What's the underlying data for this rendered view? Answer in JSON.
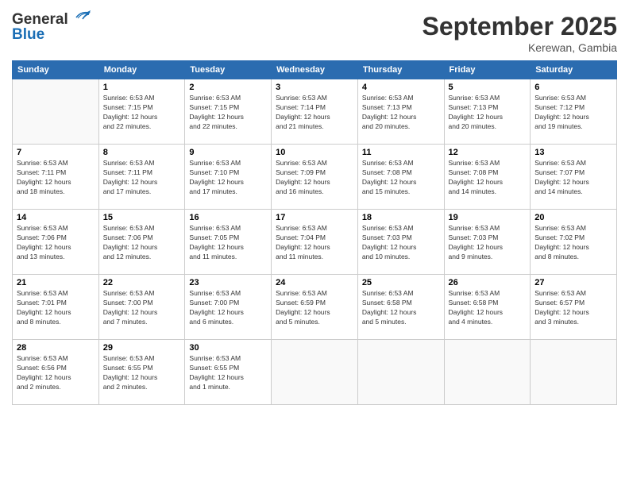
{
  "logo": {
    "line1": "General",
    "line2": "Blue"
  },
  "title": "September 2025",
  "location": "Kerewan, Gambia",
  "header_days": [
    "Sunday",
    "Monday",
    "Tuesday",
    "Wednesday",
    "Thursday",
    "Friday",
    "Saturday"
  ],
  "weeks": [
    [
      {
        "day": "",
        "info": ""
      },
      {
        "day": "1",
        "info": "Sunrise: 6:53 AM\nSunset: 7:15 PM\nDaylight: 12 hours\nand 22 minutes."
      },
      {
        "day": "2",
        "info": "Sunrise: 6:53 AM\nSunset: 7:15 PM\nDaylight: 12 hours\nand 22 minutes."
      },
      {
        "day": "3",
        "info": "Sunrise: 6:53 AM\nSunset: 7:14 PM\nDaylight: 12 hours\nand 21 minutes."
      },
      {
        "day": "4",
        "info": "Sunrise: 6:53 AM\nSunset: 7:13 PM\nDaylight: 12 hours\nand 20 minutes."
      },
      {
        "day": "5",
        "info": "Sunrise: 6:53 AM\nSunset: 7:13 PM\nDaylight: 12 hours\nand 20 minutes."
      },
      {
        "day": "6",
        "info": "Sunrise: 6:53 AM\nSunset: 7:12 PM\nDaylight: 12 hours\nand 19 minutes."
      }
    ],
    [
      {
        "day": "7",
        "info": "Sunrise: 6:53 AM\nSunset: 7:11 PM\nDaylight: 12 hours\nand 18 minutes."
      },
      {
        "day": "8",
        "info": "Sunrise: 6:53 AM\nSunset: 7:11 PM\nDaylight: 12 hours\nand 17 minutes."
      },
      {
        "day": "9",
        "info": "Sunrise: 6:53 AM\nSunset: 7:10 PM\nDaylight: 12 hours\nand 17 minutes."
      },
      {
        "day": "10",
        "info": "Sunrise: 6:53 AM\nSunset: 7:09 PM\nDaylight: 12 hours\nand 16 minutes."
      },
      {
        "day": "11",
        "info": "Sunrise: 6:53 AM\nSunset: 7:08 PM\nDaylight: 12 hours\nand 15 minutes."
      },
      {
        "day": "12",
        "info": "Sunrise: 6:53 AM\nSunset: 7:08 PM\nDaylight: 12 hours\nand 14 minutes."
      },
      {
        "day": "13",
        "info": "Sunrise: 6:53 AM\nSunset: 7:07 PM\nDaylight: 12 hours\nand 14 minutes."
      }
    ],
    [
      {
        "day": "14",
        "info": "Sunrise: 6:53 AM\nSunset: 7:06 PM\nDaylight: 12 hours\nand 13 minutes."
      },
      {
        "day": "15",
        "info": "Sunrise: 6:53 AM\nSunset: 7:06 PM\nDaylight: 12 hours\nand 12 minutes."
      },
      {
        "day": "16",
        "info": "Sunrise: 6:53 AM\nSunset: 7:05 PM\nDaylight: 12 hours\nand 11 minutes."
      },
      {
        "day": "17",
        "info": "Sunrise: 6:53 AM\nSunset: 7:04 PM\nDaylight: 12 hours\nand 11 minutes."
      },
      {
        "day": "18",
        "info": "Sunrise: 6:53 AM\nSunset: 7:03 PM\nDaylight: 12 hours\nand 10 minutes."
      },
      {
        "day": "19",
        "info": "Sunrise: 6:53 AM\nSunset: 7:03 PM\nDaylight: 12 hours\nand 9 minutes."
      },
      {
        "day": "20",
        "info": "Sunrise: 6:53 AM\nSunset: 7:02 PM\nDaylight: 12 hours\nand 8 minutes."
      }
    ],
    [
      {
        "day": "21",
        "info": "Sunrise: 6:53 AM\nSunset: 7:01 PM\nDaylight: 12 hours\nand 8 minutes."
      },
      {
        "day": "22",
        "info": "Sunrise: 6:53 AM\nSunset: 7:00 PM\nDaylight: 12 hours\nand 7 minutes."
      },
      {
        "day": "23",
        "info": "Sunrise: 6:53 AM\nSunset: 7:00 PM\nDaylight: 12 hours\nand 6 minutes."
      },
      {
        "day": "24",
        "info": "Sunrise: 6:53 AM\nSunset: 6:59 PM\nDaylight: 12 hours\nand 5 minutes."
      },
      {
        "day": "25",
        "info": "Sunrise: 6:53 AM\nSunset: 6:58 PM\nDaylight: 12 hours\nand 5 minutes."
      },
      {
        "day": "26",
        "info": "Sunrise: 6:53 AM\nSunset: 6:58 PM\nDaylight: 12 hours\nand 4 minutes."
      },
      {
        "day": "27",
        "info": "Sunrise: 6:53 AM\nSunset: 6:57 PM\nDaylight: 12 hours\nand 3 minutes."
      }
    ],
    [
      {
        "day": "28",
        "info": "Sunrise: 6:53 AM\nSunset: 6:56 PM\nDaylight: 12 hours\nand 2 minutes."
      },
      {
        "day": "29",
        "info": "Sunrise: 6:53 AM\nSunset: 6:55 PM\nDaylight: 12 hours\nand 2 minutes."
      },
      {
        "day": "30",
        "info": "Sunrise: 6:53 AM\nSunset: 6:55 PM\nDaylight: 12 hours\nand 1 minute."
      },
      {
        "day": "",
        "info": ""
      },
      {
        "day": "",
        "info": ""
      },
      {
        "day": "",
        "info": ""
      },
      {
        "day": "",
        "info": ""
      }
    ]
  ]
}
